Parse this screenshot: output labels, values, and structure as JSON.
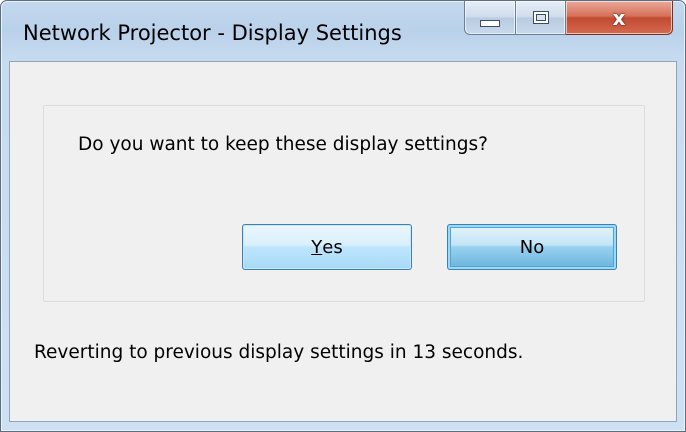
{
  "window": {
    "title": "Network Projector - Display Settings",
    "caption_buttons": {
      "minimize": "minimize-icon",
      "maximize": "maximize-icon",
      "close": "close-icon",
      "close_glyph": "x"
    }
  },
  "dialog": {
    "question": "Do you want to keep these display settings?",
    "yes_accel": "Y",
    "yes_rest": "es",
    "no_label": "No",
    "status": "Reverting to previous display settings in 13 seconds."
  },
  "colors": {
    "close_button": "#c24a33",
    "button_border": "#3c7fb1",
    "client_background": "#f0f0f0",
    "frame": "#b9d1ea"
  }
}
